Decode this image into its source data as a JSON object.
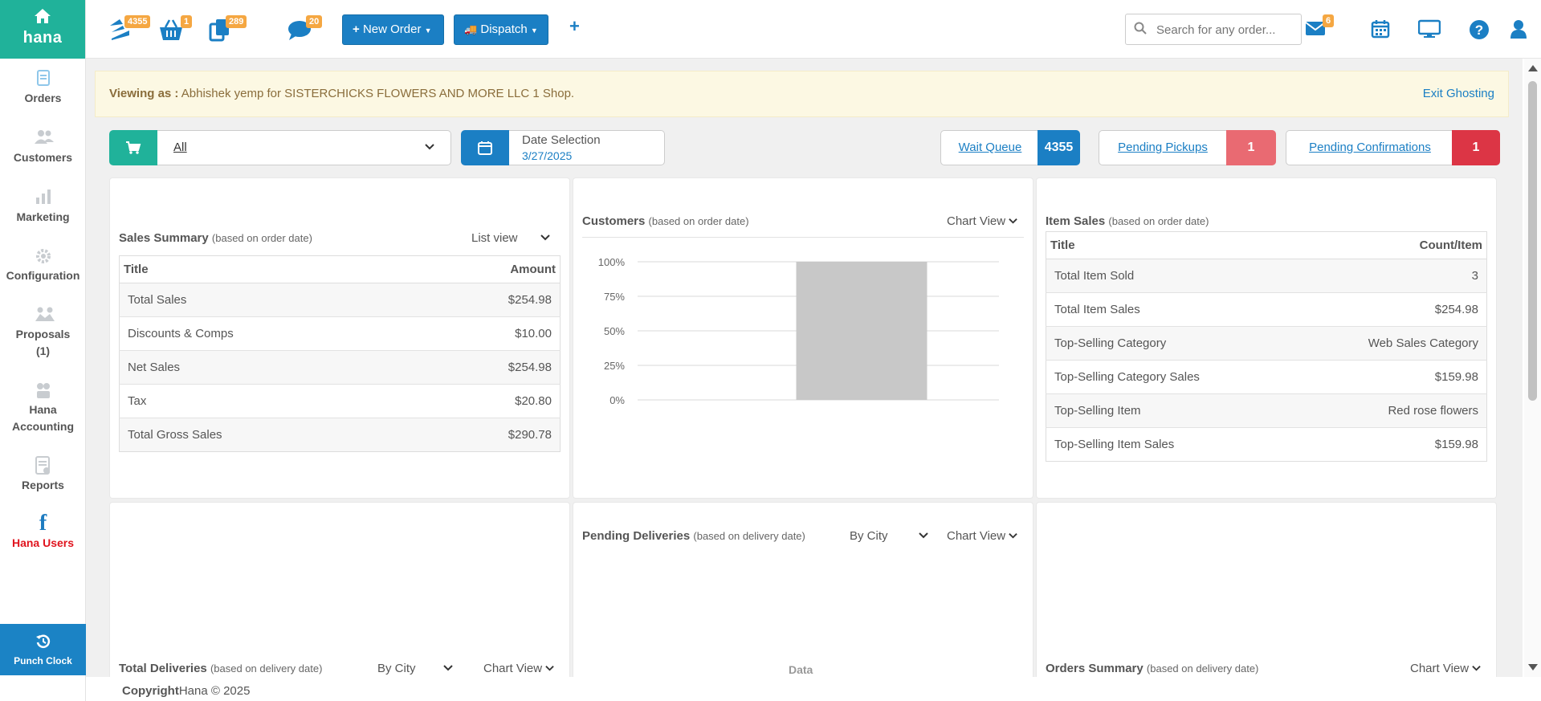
{
  "brand": {
    "name": "hana"
  },
  "sidebar": {
    "items": [
      {
        "label": "Orders",
        "icon": "orders-icon"
      },
      {
        "label": "Customers",
        "icon": "customers-icon"
      },
      {
        "label": "Marketing",
        "icon": "marketing-icon"
      },
      {
        "label": "Configuration",
        "icon": "gear-icon"
      },
      {
        "label": "Proposals",
        "label2": "(1)",
        "icon": "proposals-icon"
      },
      {
        "label": "Hana",
        "label2": "Accounting",
        "icon": "accounting-icon"
      },
      {
        "label": "Reports",
        "icon": "reports-icon"
      },
      {
        "label": "Hana Users",
        "icon": "facebook-icon"
      }
    ],
    "punch_clock": "Punch Clock"
  },
  "topbar": {
    "badges": {
      "queue": "4355",
      "basket": "1",
      "copies": "289",
      "chat": "20",
      "mail": "6"
    },
    "new_order": "New Order",
    "dispatch": "Dispatch",
    "search_placeholder": "Search for any order..."
  },
  "ghost": {
    "label": "Viewing as :",
    "text": "Abhishek yemp for SISTERCHICKS FLOWERS AND MORE LLC 1 Shop.",
    "exit": "Exit Ghosting"
  },
  "filters": {
    "store": "All",
    "date_label": "Date Selection",
    "date_value": "3/27/2025",
    "wait_queue": {
      "label": "Wait Queue",
      "count": "4355"
    },
    "pending_pickups": {
      "label": "Pending Pickups",
      "count": "1"
    },
    "pending_confirmations": {
      "label": "Pending Confirmations",
      "count": "1"
    }
  },
  "sales_summary": {
    "title": "Sales Summary",
    "sub": "(based on order date)",
    "view": "List view",
    "col_title": "Title",
    "col_amount": "Amount",
    "rows": [
      {
        "title": "Total Sales",
        "amount": "$254.98"
      },
      {
        "title": "Discounts & Comps",
        "amount": "$10.00"
      },
      {
        "title": "Net Sales",
        "amount": "$254.98"
      },
      {
        "title": "Tax",
        "amount": "$20.80"
      },
      {
        "title": "Total Gross Sales",
        "amount": "$290.78"
      }
    ]
  },
  "customers": {
    "title": "Customers",
    "sub": "(based on order date)",
    "view": "Chart View"
  },
  "chart_data": {
    "type": "bar",
    "title": "Customers",
    "categories": [
      ""
    ],
    "values": [
      100
    ],
    "yticks": [
      "100%",
      "75%",
      "50%",
      "25%",
      "0%"
    ],
    "ylim": [
      0,
      100
    ],
    "color": "#c8c8c8",
    "grid": true
  },
  "item_sales": {
    "title": "Item Sales",
    "sub": "(based on order date)",
    "col_title": "Title",
    "col_count": "Count/Item",
    "rows": [
      {
        "title": "Total Item Sold",
        "value": "3"
      },
      {
        "title": "Total Item Sales",
        "value": "$254.98"
      },
      {
        "title": "Top-Selling Category",
        "value": "Web Sales Category"
      },
      {
        "title": "Top-Selling Category Sales",
        "value": "$159.98"
      },
      {
        "title": "Top-Selling Item",
        "value": "Red rose flowers"
      },
      {
        "title": "Top-Selling Item Sales",
        "value": "$159.98"
      }
    ]
  },
  "total_deliveries": {
    "title": "Total Deliveries",
    "sub": "(based on delivery date)",
    "group": "By City",
    "view": "Chart View"
  },
  "pending_deliveries": {
    "title": "Pending Deliveries",
    "sub": "(based on delivery date)",
    "group": "By City",
    "view": "Chart View",
    "placeholder": "Data"
  },
  "orders_summary": {
    "title": "Orders Summary",
    "sub": "(based on delivery date)",
    "view": "Chart View"
  },
  "footer": {
    "copyright": "Copyright",
    "text": "Hana © 2025"
  }
}
